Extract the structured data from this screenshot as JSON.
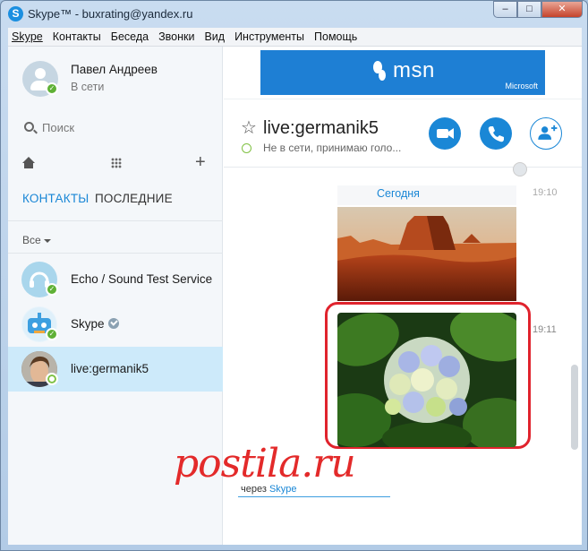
{
  "window": {
    "title": "Skype™ - buxrating@yandex.ru",
    "minimize_glyph": "–",
    "maximize_glyph": "□",
    "close_glyph": "✕"
  },
  "menu": [
    "Skype",
    "Контакты",
    "Беседа",
    "Звонки",
    "Вид",
    "Инструменты",
    "Помощь"
  ],
  "profile": {
    "name": "Павел Андреев",
    "status": "В сети"
  },
  "search": {
    "placeholder": "Поиск"
  },
  "tabs": {
    "contacts": "КОНТАКТЫ",
    "recent": "ПОСЛЕДНИЕ"
  },
  "filter": {
    "label": "Все"
  },
  "contacts": [
    {
      "name": "Echo / Sound Test Service",
      "status": "online"
    },
    {
      "name": "Skype",
      "status": "online",
      "verified": true
    },
    {
      "name": "live:germanik5",
      "status": "offline",
      "selected": true
    }
  ],
  "ad": {
    "brand": "msn",
    "sponsor": "Microsoft"
  },
  "chat": {
    "title": "live:germanik5",
    "status": "Не в сети, принимаю голо...",
    "date_label": "Сегодня",
    "time_first": "19:10",
    "time_second": "19:11",
    "via_prefix": "через",
    "via_link": "Skype"
  },
  "watermark": "postila.ru",
  "colors": {
    "accent": "#1a87d6",
    "online": "#5fb136",
    "highlight_frame": "#e0232d",
    "watermark": "#e32a2a"
  }
}
